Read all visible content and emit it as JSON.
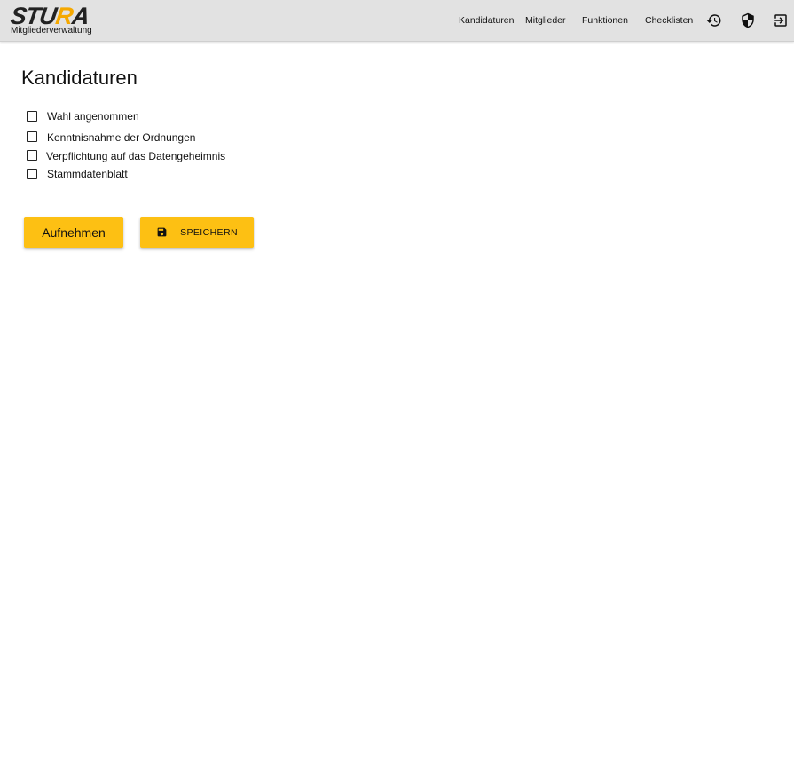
{
  "header": {
    "logo_text_main": "STU",
    "logo_text_accent": "R",
    "logo_text_end": "A",
    "logo_subtitle": "Mitgliederverwaltung",
    "nav": [
      {
        "label": "Kandidaturen"
      },
      {
        "label": "Mitglieder"
      },
      {
        "label": "Funktionen"
      },
      {
        "label": "Checklisten"
      }
    ],
    "icons": [
      "history-icon",
      "shield-icon",
      "logout-icon"
    ]
  },
  "main": {
    "title": "Kandidaturen",
    "checkboxes": [
      {
        "label": "Wahl angenommen",
        "checked": false
      },
      {
        "label": "Kenntnisnahme der Ordnungen",
        "checked": false
      },
      {
        "label": "Verpflichtung auf das Datengeheimnis",
        "checked": false
      },
      {
        "label": "Stammdatenblatt",
        "checked": false
      }
    ],
    "buttons": {
      "aufnehmen_label": "Aufnehmen",
      "speichern_label": "SPEICHERN"
    }
  },
  "colors": {
    "header_bg": "#e2e2e2",
    "accent": "#fdc013",
    "logo_accent": "#f5a800"
  }
}
